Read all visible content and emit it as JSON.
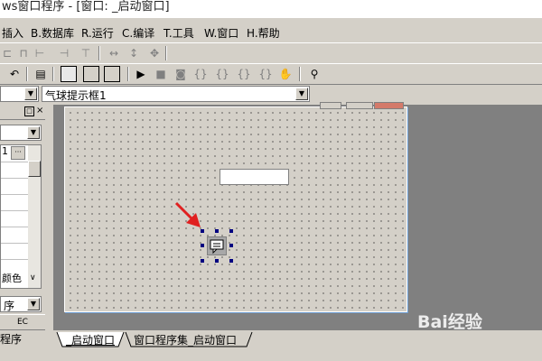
{
  "window": {
    "title": "ws窗口程序 - [窗口: _启动窗口]"
  },
  "menu": [
    {
      "label": "插入"
    },
    {
      "label": "B.数据库"
    },
    {
      "label": "R.运行"
    },
    {
      "label": "C.编译"
    },
    {
      "label": "T.工具"
    },
    {
      "label": "W.窗口"
    },
    {
      "label": "H.帮助"
    }
  ],
  "property_bar": {
    "object_selector": "",
    "component_selector": "气球提示框1"
  },
  "left_panel": {
    "cell_value": "1",
    "ellipsis": "···",
    "label_color": "颜色",
    "label_order": "序",
    "footer_1": "EC",
    "footer_2": "程序"
  },
  "tabs": [
    {
      "label": "_启动窗口"
    },
    {
      "label": "窗口程序集_启动窗口"
    }
  ],
  "watermark": {
    "text": "Bai经验"
  },
  "colors": {
    "workspace": "#808080",
    "handle": "#000080",
    "arrow": "#e02020"
  }
}
